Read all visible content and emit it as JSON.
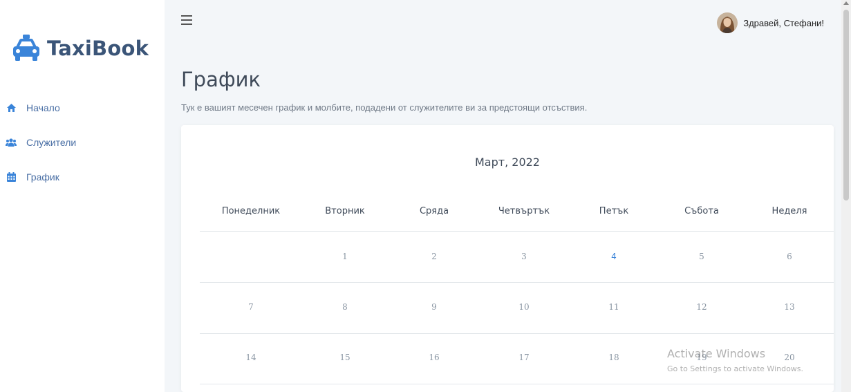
{
  "app": {
    "name": "TaxiBook",
    "brand_color": "#3b5578",
    "accent_color": "#4a6fa5"
  },
  "sidebar": {
    "items": [
      {
        "label": "Начало",
        "icon": "home-icon"
      },
      {
        "label": "Служители",
        "icon": "users-icon"
      },
      {
        "label": "График",
        "icon": "calendar-icon"
      }
    ]
  },
  "header": {
    "greeting": "Здравей, Стефани!",
    "menu_icon": "hamburger-icon"
  },
  "page": {
    "title": "График",
    "subtitle": "Тук е вашият месечен график и молбите, подадени от служителите ви за предстоящи отсъствия."
  },
  "calendar": {
    "month": "Март, 2022",
    "weekdays": [
      "Понеделник",
      "Вторник",
      "Сряда",
      "Четвъртък",
      "Петък",
      "Събота",
      "Неделя"
    ],
    "weeks": [
      [
        "",
        "1",
        "2",
        "3",
        "4",
        "5",
        "6"
      ],
      [
        "7",
        "8",
        "9",
        "10",
        "11",
        "12",
        "13"
      ],
      [
        "14",
        "15",
        "16",
        "17",
        "18",
        "19",
        "20"
      ]
    ],
    "highlighted_day": "4",
    "highlight_color": "#3a84d9"
  },
  "watermark": {
    "title": "Activate Windows",
    "subtitle": "Go to Settings to activate Windows."
  }
}
